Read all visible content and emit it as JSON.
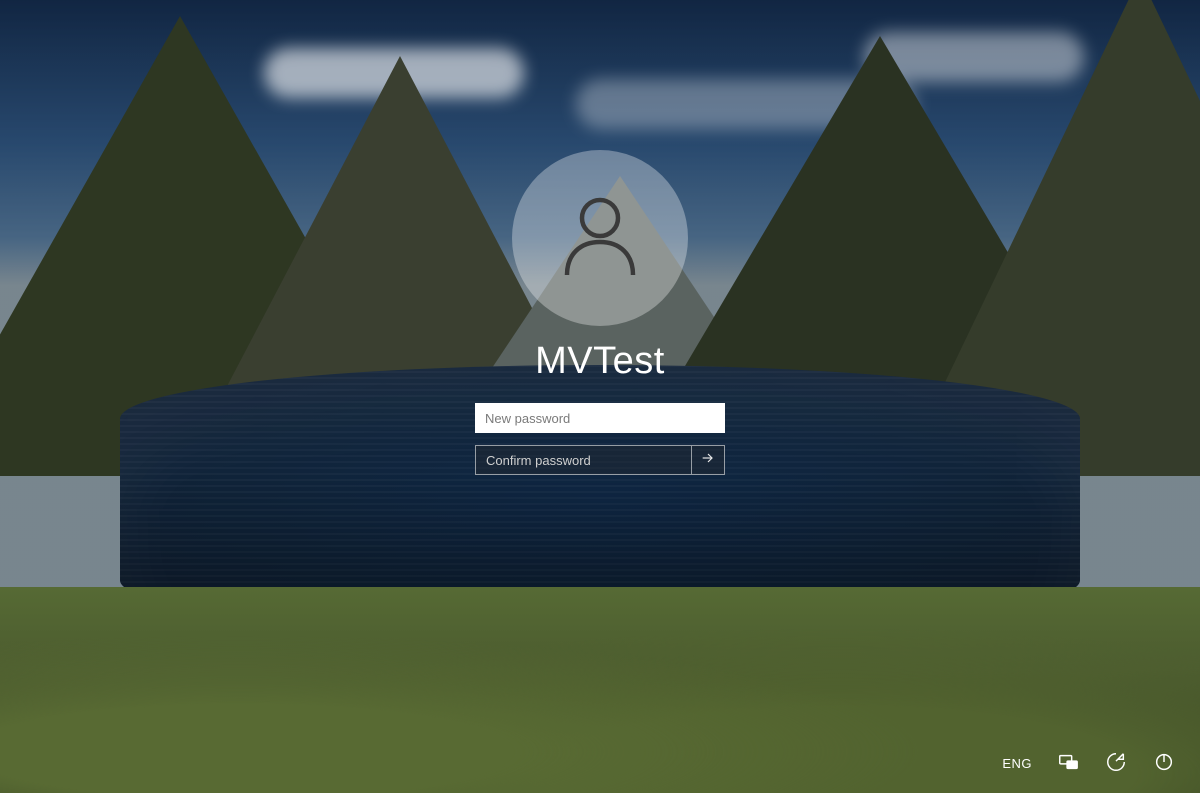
{
  "login": {
    "username": "MVTest",
    "new_password_placeholder": "New password",
    "confirm_password_placeholder": "Confirm password",
    "new_password_value": "",
    "confirm_password_value": ""
  },
  "tray": {
    "language": "ENG"
  },
  "icons": {
    "avatar": "user-icon",
    "submit": "arrow-right-icon",
    "network": "network-icon",
    "ease_of_access": "ease-of-access-icon",
    "power": "power-icon"
  }
}
